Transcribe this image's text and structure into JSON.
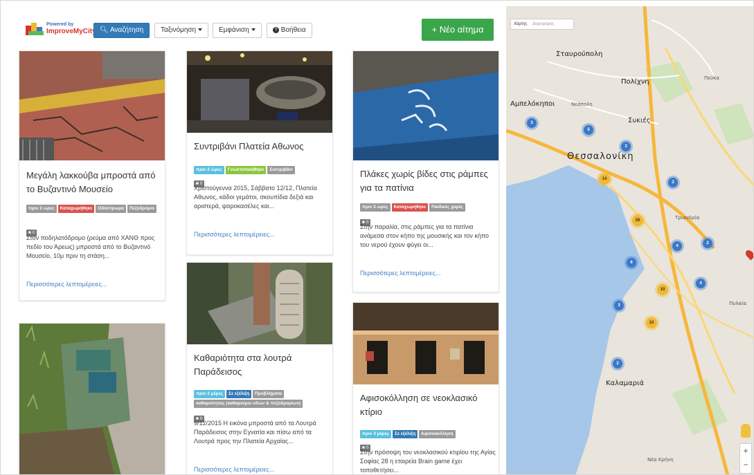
{
  "nav": {
    "logo_powered": "Powered by",
    "logo_name": "ImproveMyCity",
    "search": "Αναζήτηση",
    "sort": "Ταξινόμηση",
    "view": "Εμφάνιση",
    "help": "Βοήθεια",
    "new_issue": "+ Νέο αίτημα"
  },
  "cards": [
    {
      "title": "Μεγάλη λακκούβα μπροστά από το Βυζαντινό Μουσείο",
      "tags": [
        {
          "label": "πριν 2 ώρες",
          "color": "#9a9a9a"
        },
        {
          "label": "Καταχωρήθηκε",
          "color": "#d9534f"
        },
        {
          "label": "Οδόστρωμα",
          "color": "#9a9a9a"
        },
        {
          "label": "Πεζοδρόμιο",
          "color": "#9a9a9a"
        }
      ],
      "comments": "0",
      "description": "Στον ποδηλατόδρομο (ρεύμα από ΧΑΝΘ προς πεδίο του Άρεως) μπροστά από το Βυζαντινό Μουσείο, 10μ πριν τη στάση...",
      "more": "Περισσότερες λεπτομέρειες..."
    },
    {
      "title": "Συντριβάνι Πλατεία Αθωνος",
      "tags": [
        {
          "label": "πριν 2 ώρες",
          "color": "#5bc0de"
        },
        {
          "label": "Γνωστοποιήθηκε",
          "color": "#8cc63f"
        },
        {
          "label": "Συντριβάνι",
          "color": "#9a9a9a"
        }
      ],
      "comments": "0",
      "description": "Χριστούγεννα 2015, Σάββατο 12/12, Πλατεία Αθωνος, κάδοι γεμάτοι, σκουπίδια δεξιά και αριστερά, ψαροκασέλες και...",
      "more": "Περισσότερες λεπτομέρειες..."
    },
    {
      "title": "Πλάκες χωρίς βίδες στις ράμπες για τα πατίνια",
      "tags": [
        {
          "label": "πριν 2 ώρες",
          "color": "#9a9a9a"
        },
        {
          "label": "Καταχωρήθηκε",
          "color": "#d9534f"
        },
        {
          "label": "Παιδικές χαρές",
          "color": "#9a9a9a"
        }
      ],
      "comments": "0",
      "description": "Στην παραλία, στις ράμπες για τα πατίνια ανάμεσα στον κήπο της μουσικής και τον κήπο του νερού έχουν φύγει οι...",
      "more": "Περισσότερες λεπτομέρειες..."
    },
    {
      "title": "Καθαριότητα στα λουτρά Παράδεισος",
      "tags": [
        {
          "label": "πριν 2 μέρες",
          "color": "#5bc0de"
        },
        {
          "label": "Σε εξέλιξη",
          "color": "#337ab7"
        },
        {
          "label": "Προβλήματα",
          "color": "#9a9a9a"
        },
        {
          "label": "καθαριότητας (καθαρισμοι οδών & πεζοδρομίων)",
          "color": "#9a9a9a"
        }
      ],
      "comments": "0",
      "description": "9/12/2015 Η εικόνα μπροστά από τα Λουτρά Παράδεισος στην Εγνατία και πίσω από τα Λουτρά προς την Πλατεία Αρχαίας...",
      "more": "Περισσότερες λεπτομέρειες..."
    },
    {
      "title": "Αφισοκόλληση σε νεοκλασικό κτίριο",
      "tags": [
        {
          "label": "πριν 3 μέρες",
          "color": "#5bc0de"
        },
        {
          "label": "Σε εξέλιξη",
          "color": "#337ab7"
        },
        {
          "label": "Αφισοκόλληση",
          "color": "#9a9a9a"
        }
      ],
      "comments": "0",
      "description": "Στην πρόσοψη του νεοκλασικού κτιρίου της Αγίας Σοφίας 28 η εταιρεία Brain game έχει τοποθετήσει...",
      "more": "Περισσότερες λεπτομέρειες..."
    }
  ],
  "map": {
    "tab_map": "Χάρτης",
    "tab_satellite": "Δορυφόρος",
    "labels": {
      "stavroupoli": "Σταυρούπολη",
      "polichni": "Πολίχνη",
      "ampelokipoi": "Αμπελόκηποι",
      "neapoli": "Νεάπολη",
      "sykies": "Συκιές",
      "pefka": "Πεύκα",
      "thessaloniki": "Θεσσαλονίκη",
      "triandria": "Τριανδρία",
      "pylaia": "Πυλαία",
      "kalamaria": "Καλαμαριά",
      "nea_krini": "Νέα Κρήνη"
    },
    "clusters": [
      {
        "count": "3",
        "kind": "blue"
      },
      {
        "count": "5",
        "kind": "blue"
      },
      {
        "count": "3",
        "kind": "blue"
      },
      {
        "count": "14",
        "kind": "yellow"
      },
      {
        "count": "2",
        "kind": "blue"
      },
      {
        "count": "26",
        "kind": "yellow"
      },
      {
        "count": "4",
        "kind": "blue"
      },
      {
        "count": "2",
        "kind": "blue"
      },
      {
        "count": "6",
        "kind": "blue"
      },
      {
        "count": "10",
        "kind": "yellow"
      },
      {
        "count": "4",
        "kind": "blue"
      },
      {
        "count": "3",
        "kind": "blue"
      },
      {
        "count": "10",
        "kind": "yellow"
      },
      {
        "count": "2",
        "kind": "blue"
      }
    ],
    "zoom_in": "+",
    "zoom_out": "−"
  },
  "colors": {
    "primary": "#337ab7",
    "success": "#3aa54a",
    "link": "#3b7fc4"
  }
}
